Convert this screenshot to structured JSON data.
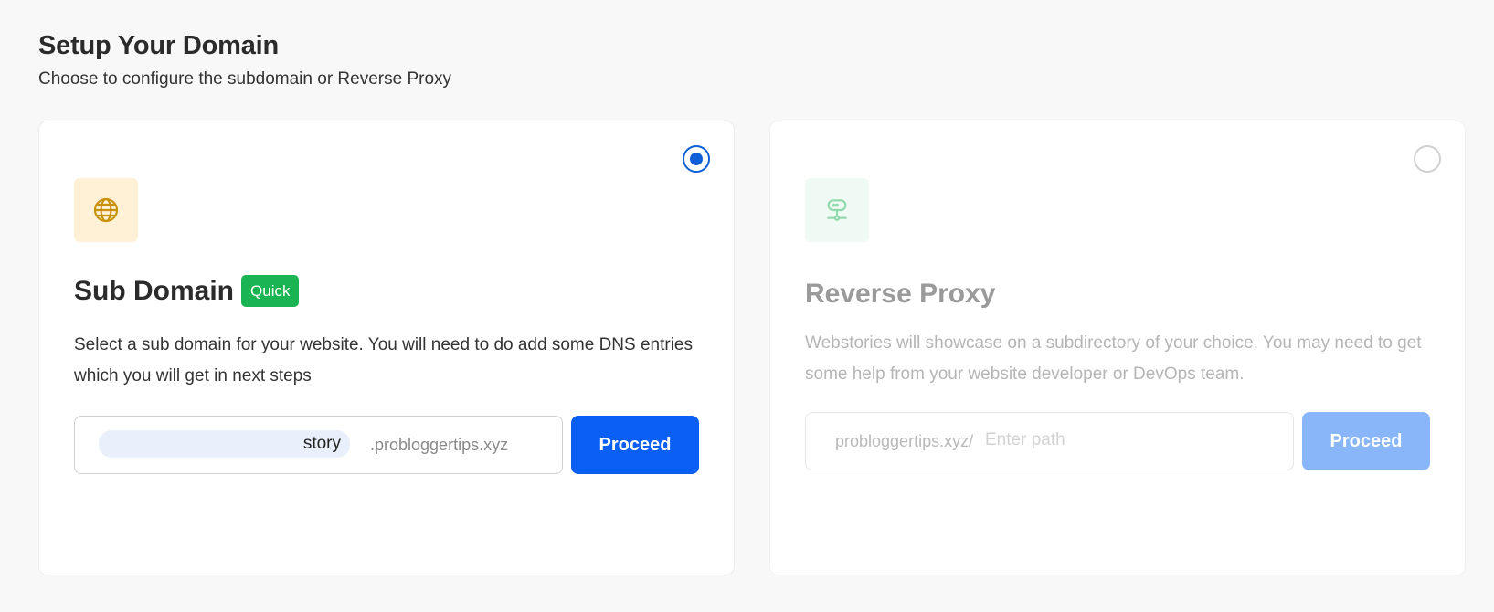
{
  "header": {
    "title": "Setup Your Domain",
    "subtitle": "Choose to configure the subdomain or Reverse Proxy"
  },
  "sub_domain": {
    "icon": "globe-icon",
    "title": "Sub Domain",
    "badge": "Quick",
    "description": "Select a sub domain for your website. You will need to do add some DNS entries which you will get in next steps",
    "input_value": "story",
    "suffix": ".probloggertips.xyz",
    "button_label": "Proceed",
    "selected": true
  },
  "reverse_proxy": {
    "icon": "network-icon",
    "title": "Reverse Proxy",
    "description": "Webstories will showcase on a subdirectory of your choice. You may need to get some help from your website developer or DevOps team.",
    "prefix": "probloggertips.xyz/",
    "input_placeholder": "Enter path",
    "button_label": "Proceed",
    "selected": false
  },
  "colors": {
    "primary": "#0b5ff5",
    "primary_disabled": "#89b5f9",
    "badge_green": "#1ab552",
    "globe_tile": "#fff1d6",
    "proxy_tile": "#eefaf3"
  }
}
